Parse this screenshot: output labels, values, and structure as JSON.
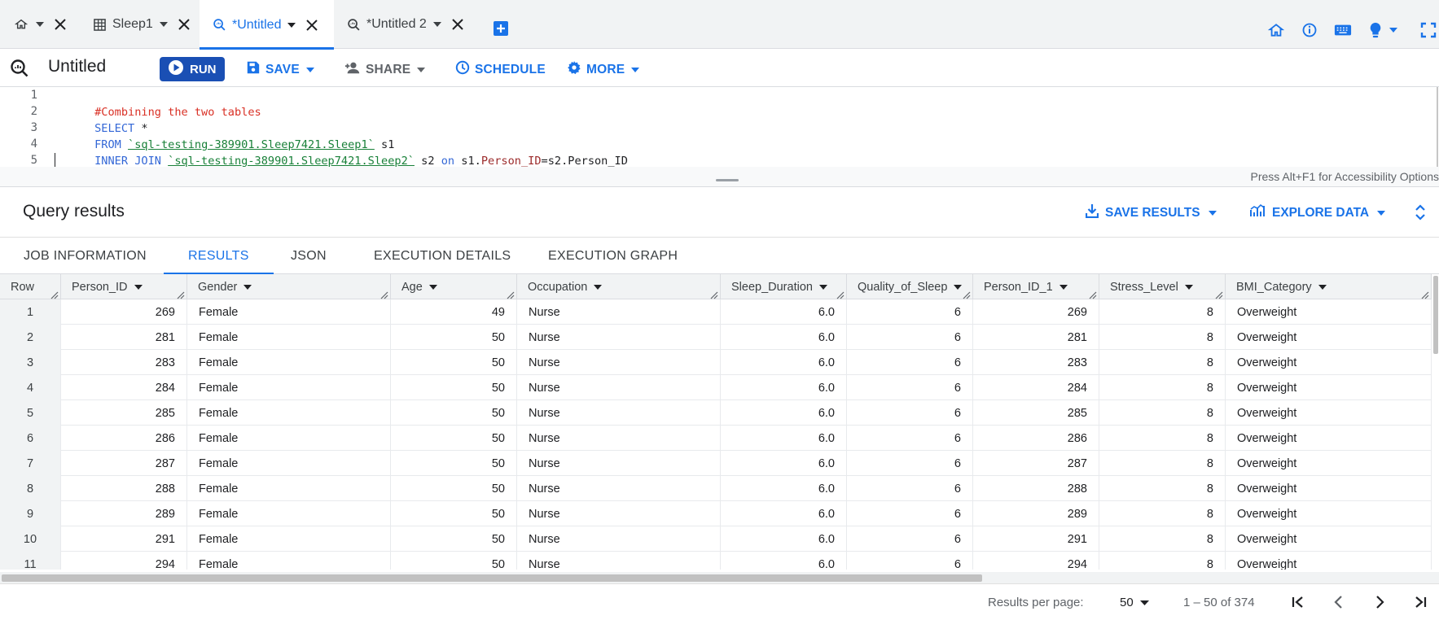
{
  "tabs": [
    {
      "label": "",
      "icon": "home-icon",
      "active": false
    },
    {
      "label": "Sleep1",
      "icon": "table-icon",
      "active": false
    },
    {
      "label": "*Untitled",
      "icon": "query-icon",
      "active": true
    },
    {
      "label": "*Untitled 2",
      "icon": "query-icon",
      "active": false
    }
  ],
  "toolbar": {
    "title": "Untitled",
    "run_label": "RUN",
    "save_label": "SAVE",
    "share_label": "SHARE",
    "schedule_label": "SCHEDULE",
    "more_label": "MORE"
  },
  "editor": {
    "line_numbers": [
      "1",
      "2",
      "3",
      "4",
      "5"
    ],
    "line1_comment": "#Combining the two tables",
    "line2_kw": "SELECT",
    "line2_rest": " *",
    "line3_kw": "FROM",
    "line3_table": "`sql-testing-389901.Sleep7421.Sleep1`",
    "line3_alias": " s1",
    "line4_kw": "INNER JOIN",
    "line4_table": "`sql-testing-389901.Sleep7421.Sleep2`",
    "line4_alias": " s2 ",
    "line4_on": "on",
    "line4_s1": " s1.",
    "line4_col1": "Person_ID",
    "line4_eq": "=s2.",
    "line4_col2": "Person_ID",
    "accessibility_hint": "Press Alt+F1 for Accessibility Options"
  },
  "results": {
    "title": "Query results",
    "save_results_label": "SAVE RESULTS",
    "explore_data_label": "EXPLORE DATA",
    "tabs": [
      "JOB INFORMATION",
      "RESULTS",
      "JSON",
      "EXECUTION DETAILS",
      "EXECUTION GRAPH"
    ],
    "active_tab": "RESULTS",
    "columns": [
      "Row",
      "Person_ID",
      "Gender",
      "Age",
      "Occupation",
      "Sleep_Duration",
      "Quality_of_Sleep",
      "Person_ID_1",
      "Stress_Level",
      "BMI_Category"
    ],
    "rows": [
      [
        "1",
        "269",
        "Female",
        "49",
        "Nurse",
        "6.0",
        "6",
        "269",
        "8",
        "Overweight"
      ],
      [
        "2",
        "281",
        "Female",
        "50",
        "Nurse",
        "6.0",
        "6",
        "281",
        "8",
        "Overweight"
      ],
      [
        "3",
        "283",
        "Female",
        "50",
        "Nurse",
        "6.0",
        "6",
        "283",
        "8",
        "Overweight"
      ],
      [
        "4",
        "284",
        "Female",
        "50",
        "Nurse",
        "6.0",
        "6",
        "284",
        "8",
        "Overweight"
      ],
      [
        "5",
        "285",
        "Female",
        "50",
        "Nurse",
        "6.0",
        "6",
        "285",
        "8",
        "Overweight"
      ],
      [
        "6",
        "286",
        "Female",
        "50",
        "Nurse",
        "6.0",
        "6",
        "286",
        "8",
        "Overweight"
      ],
      [
        "7",
        "287",
        "Female",
        "50",
        "Nurse",
        "6.0",
        "6",
        "287",
        "8",
        "Overweight"
      ],
      [
        "8",
        "288",
        "Female",
        "50",
        "Nurse",
        "6.0",
        "6",
        "288",
        "8",
        "Overweight"
      ],
      [
        "9",
        "289",
        "Female",
        "50",
        "Nurse",
        "6.0",
        "6",
        "289",
        "8",
        "Overweight"
      ],
      [
        "10",
        "291",
        "Female",
        "50",
        "Nurse",
        "6.0",
        "6",
        "291",
        "8",
        "Overweight"
      ],
      [
        "11",
        "294",
        "Female",
        "50",
        "Nurse",
        "6.0",
        "6",
        "294",
        "8",
        "Overweight"
      ]
    ]
  },
  "pagination": {
    "per_page_label": "Results per page:",
    "per_page_value": "50",
    "range": "1 – 50 of 374"
  },
  "colors": {
    "accent": "#1a73e8",
    "run_button": "#1a4fb4",
    "keyword": "#3367d6",
    "comment": "#d93025",
    "table_ref": "#188038"
  }
}
